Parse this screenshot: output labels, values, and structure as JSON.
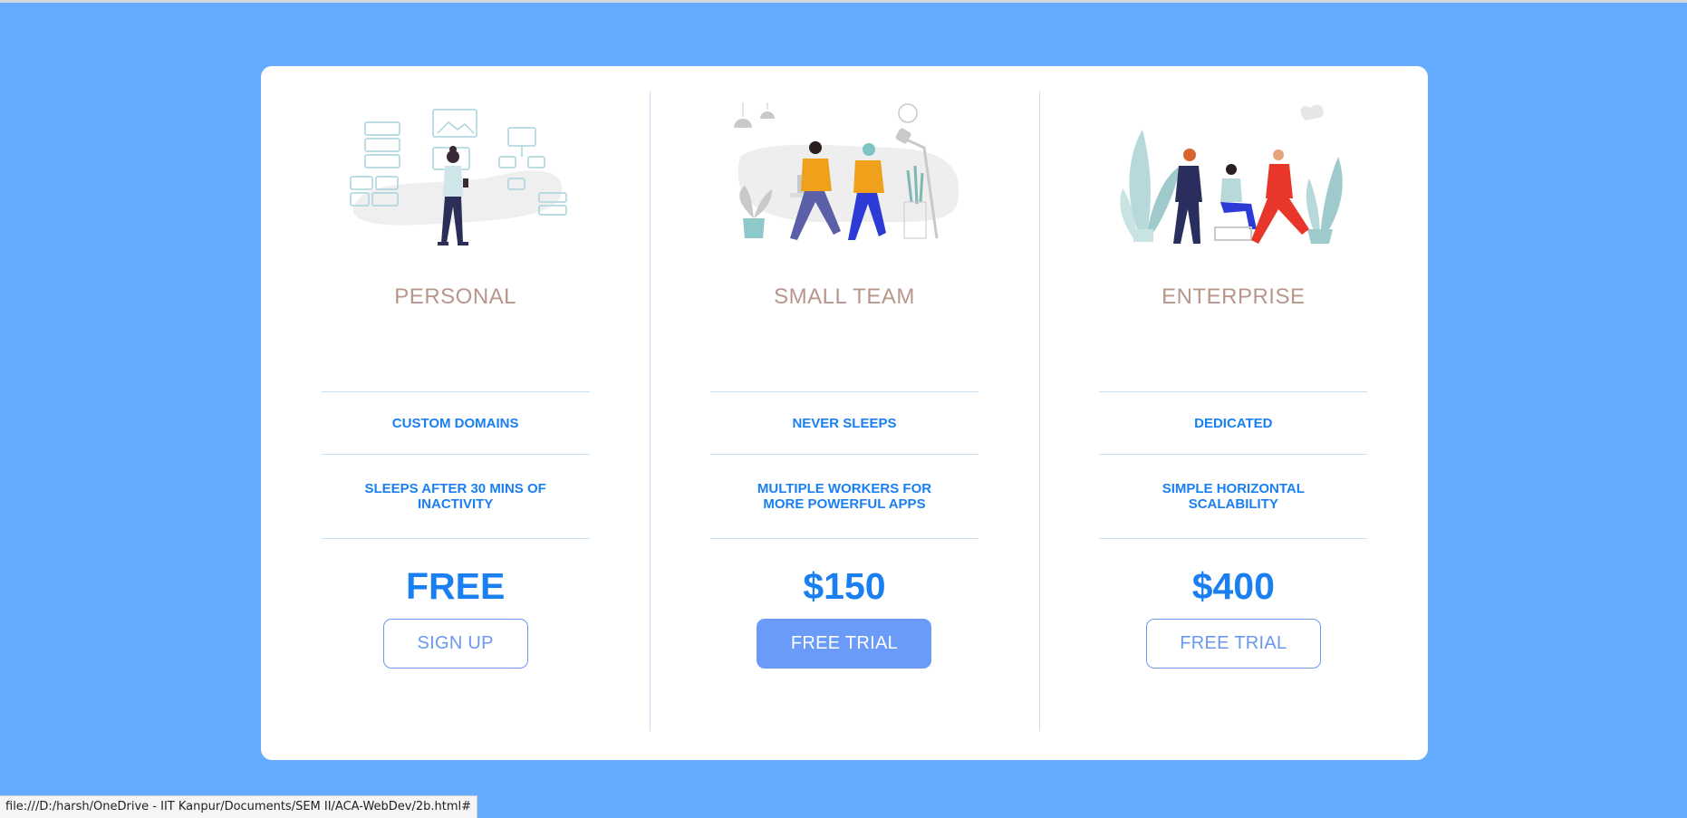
{
  "colors": {
    "page_background": "#64aaff",
    "card_background": "#ffffff",
    "plan_title": "#b8968b",
    "accent_blue": "#1a7ff0",
    "button_blue": "#6a9bf8",
    "divider": "#c8e0f7"
  },
  "plans": [
    {
      "title": "PERSONAL",
      "illustration_icon": "woman-with-ui-panels-illustration",
      "features": [
        "CUSTOM DOMAINS",
        "SLEEPS AFTER 30 MINS OF INACTIVITY"
      ],
      "price": "FREE",
      "button_label": "SIGN UP",
      "button_style": "outline"
    },
    {
      "title": "SMALL TEAM",
      "illustration_icon": "two-people-walking-illustration",
      "features": [
        "NEVER SLEEPS",
        "MULTIPLE WORKERS FOR MORE POWERFUL APPS"
      ],
      "price": "$150",
      "button_label": "FREE TRIAL",
      "button_style": "solid"
    },
    {
      "title": "ENTERPRISE",
      "illustration_icon": "team-meeting-illustration",
      "features": [
        "DEDICATED",
        "SIMPLE HORIZONTAL SCALABILITY"
      ],
      "price": "$400",
      "button_label": "FREE TRIAL",
      "button_style": "outline"
    }
  ],
  "status_bar": {
    "url": "file:///D:/harsh/OneDrive - IIT Kanpur/Documents/SEM II/ACA-WebDev/2b.html#"
  }
}
